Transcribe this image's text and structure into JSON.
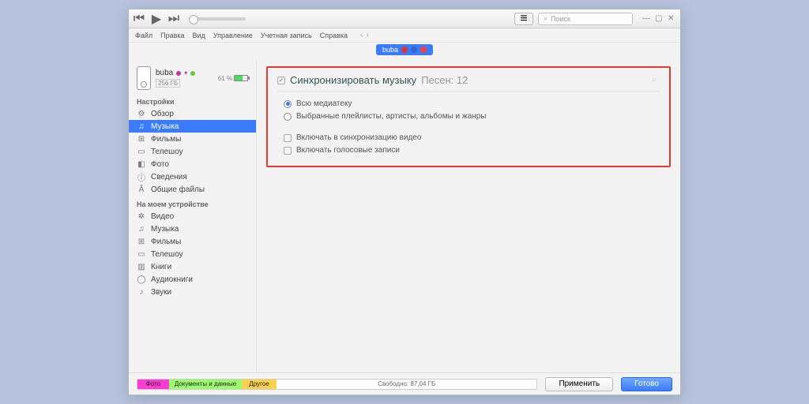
{
  "search_placeholder": "Поиск",
  "menus": [
    "Файл",
    "Правка",
    "Вид",
    "Управление",
    "Учетная запись",
    "Справка"
  ],
  "pill": "buba",
  "device": {
    "name": "buba",
    "storage": "256 ГБ",
    "batt": "61 %"
  },
  "sect_settings": "Настройки",
  "settings_items": [
    {
      "ico": "⚙",
      "label": "Обзор"
    },
    {
      "ico": "♫",
      "label": "Музыка"
    },
    {
      "ico": "⊞",
      "label": "Фильмы"
    },
    {
      "ico": "▭",
      "label": "Телешоу"
    },
    {
      "ico": "◧",
      "label": "Фото"
    },
    {
      "ico": "ⓘ",
      "label": "Сведения"
    },
    {
      "ico": "Å",
      "label": "Общие файлы"
    }
  ],
  "sect_device": "На моем устройстве",
  "device_items": [
    {
      "ico": "✲",
      "label": "Видео"
    },
    {
      "ico": "♫",
      "label": "Музыка"
    },
    {
      "ico": "⊞",
      "label": "Фильмы"
    },
    {
      "ico": "▭",
      "label": "Телешоу"
    },
    {
      "ico": "▥",
      "label": "Книги"
    },
    {
      "ico": "◯",
      "label": "Аудиокниги"
    },
    {
      "ico": "♪",
      "label": "Звуки"
    }
  ],
  "sync_title": "Синхронизировать музыку",
  "sync_count": "Песен: 12",
  "opt_all": "Всю медиатеку",
  "opt_sel": "Выбранные плейлисты, артисты, альбомы и жанры",
  "opt_vid": "Включать в синхронизацию видео",
  "opt_voice": "Включать голосовые записи",
  "usage": {
    "photo": "Фото",
    "docs": "Документы и данные",
    "other": "Другое",
    "free": "Свободно: 87,04 ГБ"
  },
  "btn_apply": "Применить",
  "btn_done": "Готово"
}
